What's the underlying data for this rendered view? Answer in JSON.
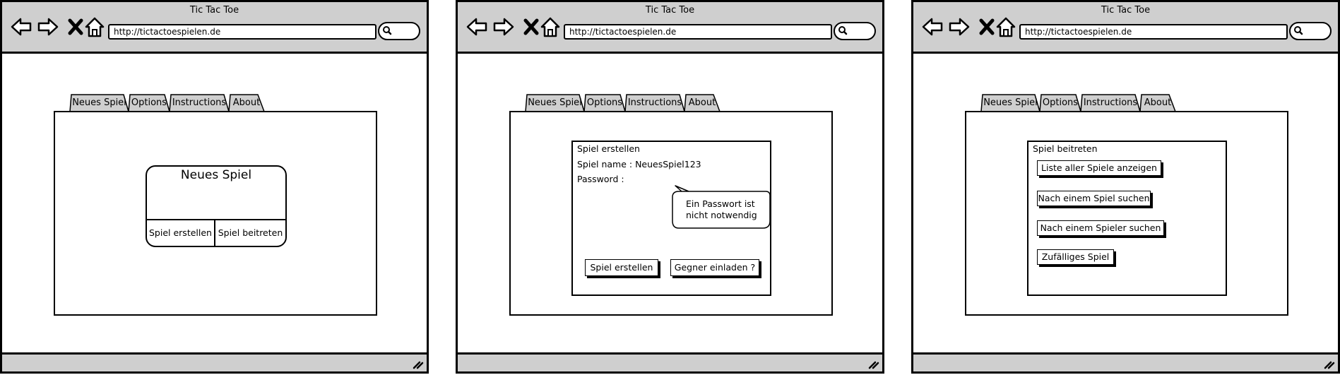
{
  "browser": {
    "title": "Tic Tac Toe",
    "url": "http://tictactoespielen.de"
  },
  "tabs": [
    "Neues Spiel",
    "Options",
    "Instructions",
    "About"
  ],
  "screen1": {
    "card_title": "Neues Spiel",
    "create_button": "Spiel erstellen",
    "join_button": "Spiel beitreten"
  },
  "screen2": {
    "dialog_title": "Spiel erstellen",
    "name_label": "Spiel name : NeuesSpiel123",
    "password_label": "Password :",
    "tooltip_line1": "Ein Passwort ist",
    "tooltip_line2": "nicht notwendig",
    "create_button": "Spiel erstellen",
    "invite_button": "Gegner einladen ?"
  },
  "screen3": {
    "dialog_title": "Spiel beitreten",
    "buttons": [
      "Liste aller Spiele anzeigen",
      "Nach einem Spiel suchen",
      "Nach einem Spieler suchen",
      "Zufälliges Spiel"
    ]
  },
  "colors": {
    "chrome": "#cfcfcf",
    "ink": "#000000",
    "paper": "#ffffff"
  },
  "icons": [
    "back-arrow-icon",
    "forward-arrow-icon",
    "close-x-icon",
    "home-icon",
    "search-icon",
    "resize-grip-icon"
  ]
}
